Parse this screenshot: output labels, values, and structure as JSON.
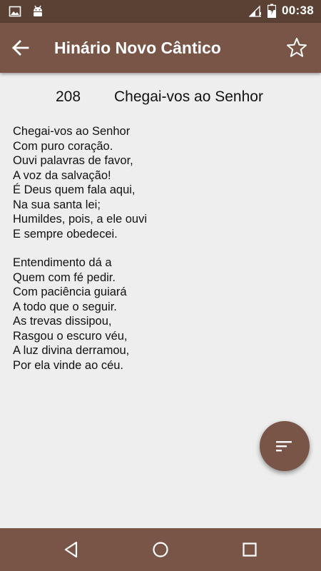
{
  "status_bar": {
    "time": "00:38",
    "icons": [
      "image-icon",
      "android-icon",
      "signal-icon",
      "battery-icon"
    ]
  },
  "app_bar": {
    "title": "Hinário Novo Cântico",
    "back_icon": "arrow-back-icon",
    "favorite_icon": "star-outline-icon"
  },
  "hymn": {
    "number": "208",
    "title": "Chegai-vos ao Senhor",
    "stanzas": [
      [
        "Chegai-vos ao Senhor",
        "Com puro coração.",
        "Ouvi palavras de favor,",
        "A voz da salvação!",
        "É Deus quem fala aqui,",
        "Na sua santa lei;",
        "Humildes, pois, a ele ouvi",
        "E sempre obedecei."
      ],
      [
        "Entendimento dá a",
        "Quem com fé pedir.",
        "Com paciência guiará",
        "A todo que o seguir.",
        "As trevas dissipou,",
        "Rasgou o escuro véu,",
        "A luz divina derramou,",
        "Por ela vinde ao céu."
      ]
    ]
  },
  "fab": {
    "icon": "sort-icon"
  },
  "nav_bar": {
    "icons": [
      "nav-back-icon",
      "nav-home-icon",
      "nav-recents-icon"
    ]
  },
  "colors": {
    "status_bar": "#5b4034",
    "app_bar": "#795548",
    "background": "#eeeeee",
    "text": "#111111"
  }
}
